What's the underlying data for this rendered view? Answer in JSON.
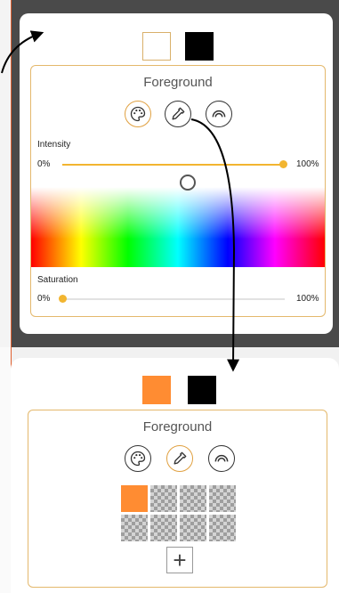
{
  "top_panel": {
    "title": "Foreground",
    "foreground_color": "#ffffff",
    "background_color": "#000000",
    "tools": [
      {
        "icon": "palette-icon",
        "active": false
      },
      {
        "icon": "eyedropper-icon",
        "active": false
      },
      {
        "icon": "arc-icon",
        "active": false
      }
    ],
    "intensity": {
      "label": "Intensity",
      "min": "0%",
      "max": "100%",
      "value": 1.0
    },
    "saturation": {
      "label": "Saturation",
      "min": "0%",
      "max": "100%",
      "value": 0.0
    }
  },
  "bottom_panel": {
    "title": "Foreground",
    "foreground_color": "#ff8c32",
    "background_color": "#000000",
    "tools": [
      {
        "icon": "palette-icon",
        "active": false
      },
      {
        "icon": "eyedropper-icon",
        "active": true
      },
      {
        "icon": "arc-icon",
        "active": false
      }
    ],
    "swatch_grid": {
      "selected_color": "#ff8c32",
      "add_label": "+"
    }
  },
  "colors": {
    "accent": "#f2b530",
    "panel_border": "#e4b86c"
  }
}
